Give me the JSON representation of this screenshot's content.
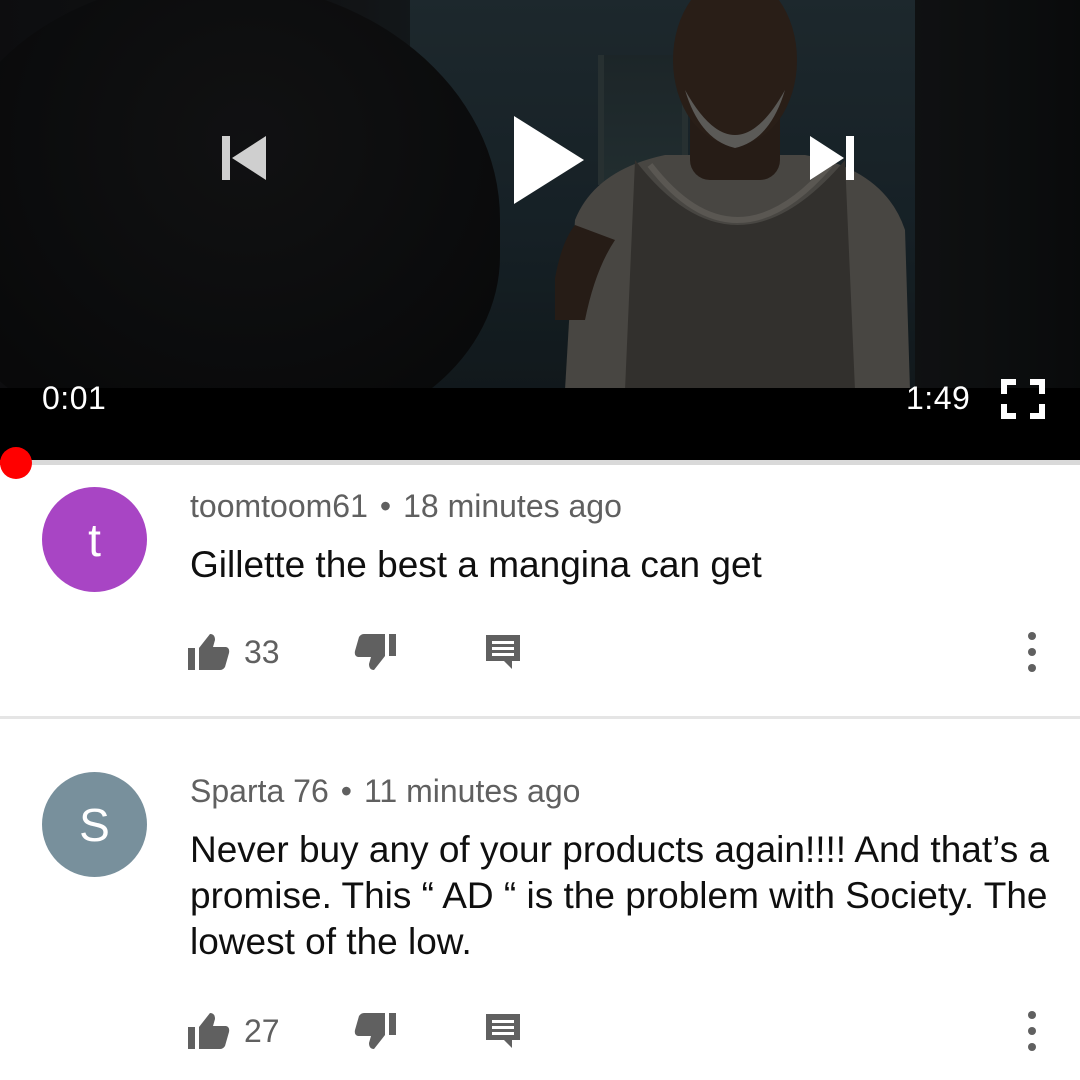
{
  "player": {
    "current_time": "0:01",
    "duration": "1:49",
    "progress_fraction": 0.009,
    "progress_color": "#ff0000",
    "controls": {
      "previous_icon": "skip-previous-icon",
      "play_icon": "play-icon",
      "next_icon": "skip-next-icon",
      "fullscreen_icon": "fullscreen-icon"
    }
  },
  "comments": [
    {
      "avatar_letter": "t",
      "avatar_color": "#a845c4",
      "author": "toomtoom61",
      "time_ago": "18 minutes ago",
      "text": "Gillette the best a mangina can get",
      "likes": "33"
    },
    {
      "avatar_letter": "S",
      "avatar_color": "#78909c",
      "author": "Sparta 76",
      "time_ago": "11 minutes ago",
      "text": "Never buy any of your products again!!!! And that’s a promise. This “ AD “ is the problem with Society. The lowest of the low.",
      "likes": "27"
    }
  ],
  "meta_separator": "•",
  "icons": {
    "like": "thumb-up-icon",
    "dislike": "thumb-down-icon",
    "reply": "reply-comment-icon",
    "more": "more-vert-icon"
  }
}
